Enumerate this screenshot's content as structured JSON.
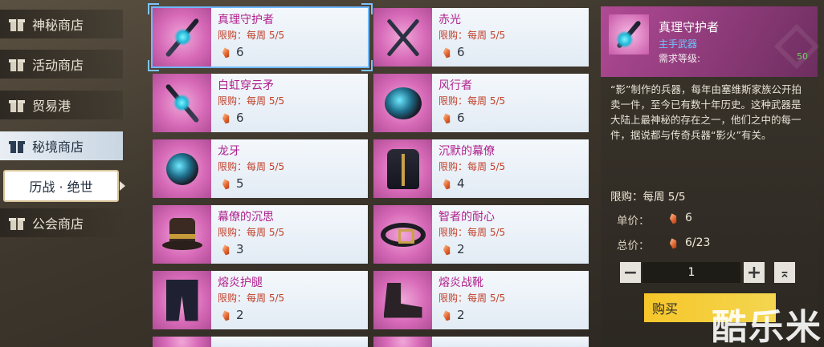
{
  "sidebar": {
    "items": [
      {
        "label": "神秘商店",
        "icon": "gift-icon"
      },
      {
        "label": "活动商店",
        "icon": "gift-icon"
      },
      {
        "label": "贸易港",
        "icon": "gift-icon"
      },
      {
        "label": "秘境商店",
        "icon": "gift-icon",
        "active": true
      },
      {
        "label": "公会商店",
        "icon": "gift-icon"
      }
    ],
    "sub_item": "历战 · 绝世"
  },
  "items": [
    {
      "name": "真理守护者",
      "limit": "限购：每周 5/5",
      "price": "6",
      "selected": true
    },
    {
      "name": "赤光",
      "limit": "限购：每周 5/5",
      "price": "6"
    },
    {
      "name": "白虹穿云矛",
      "limit": "限购：每周 5/5",
      "price": "6"
    },
    {
      "name": "风行者",
      "limit": "限购：每周 5/5",
      "price": "6"
    },
    {
      "name": "龙牙",
      "limit": "限购：每周 5/5",
      "price": "5"
    },
    {
      "name": "沉默的幕僚",
      "limit": "限购：每周 5/5",
      "price": "4"
    },
    {
      "name": "幕僚的沉思",
      "limit": "限购：每周 5/5",
      "price": "3"
    },
    {
      "name": "智者的耐心",
      "limit": "限购：每周 5/5",
      "price": "2"
    },
    {
      "name": "熔炎护腿",
      "limit": "限购：每周 5/5",
      "price": "2"
    },
    {
      "name": "熔炎战靴",
      "limit": "限购：每周 5/5",
      "price": "2"
    }
  ],
  "detail": {
    "name": "真理守护者",
    "type": "主手武器",
    "req_label": "需求等级:",
    "req_value": "50",
    "description": "“影”制作的兵器，每年由塞维斯家族公开拍卖一件，至今已有数十年历史。这种武器是大陆上最神秘的存在之一，他们之中的每一件，据说都与传奇兵器“影火”有关。",
    "limit": "限购：每周 5/5",
    "unit_price_label": "单价：",
    "unit_price": "6",
    "total_price_label": "总价：",
    "total_price": "6/23",
    "quantity": "1",
    "minus": "−",
    "plus": "+",
    "max": "⌅",
    "buy_label": "购买"
  },
  "watermark": "酷乐米",
  "colors": {
    "item_name": "#b0218d",
    "limit_text": "#c2402a",
    "buy_button": "#f6c62a",
    "weapon_type": "#69c7ff",
    "level_value": "#6fd05a"
  }
}
